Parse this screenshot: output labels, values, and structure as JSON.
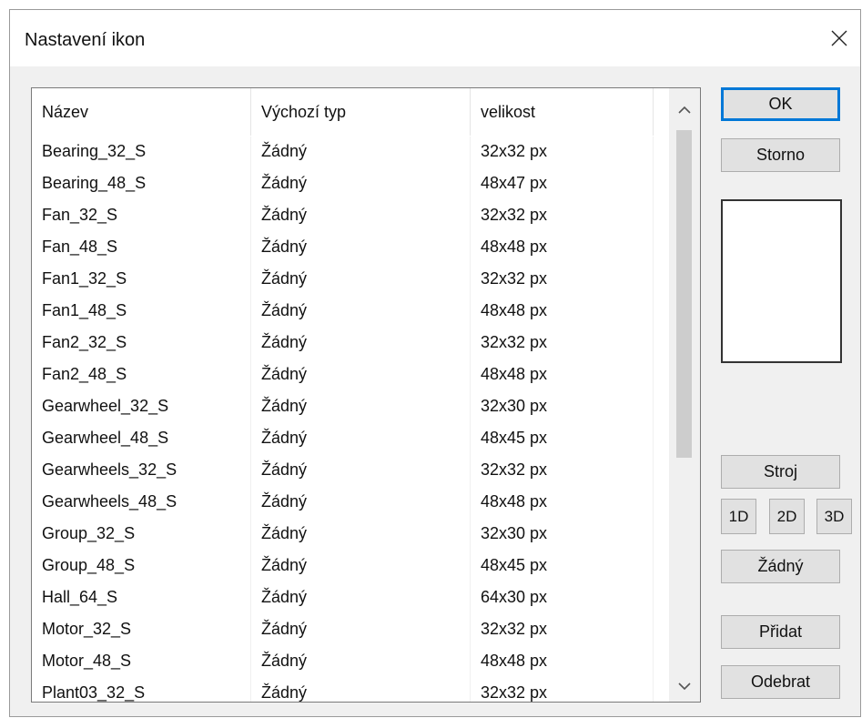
{
  "window": {
    "title": "Nastavení ikon"
  },
  "list": {
    "columns": [
      "Název",
      "Výchozí typ",
      "velikost"
    ],
    "rows": [
      {
        "name": "Bearing_32_S",
        "type": "Žádný",
        "size": "32x32 px"
      },
      {
        "name": "Bearing_48_S",
        "type": "Žádný",
        "size": "48x47 px"
      },
      {
        "name": "Fan_32_S",
        "type": "Žádný",
        "size": "32x32 px"
      },
      {
        "name": "Fan_48_S",
        "type": "Žádný",
        "size": "48x48 px"
      },
      {
        "name": "Fan1_32_S",
        "type": "Žádný",
        "size": "32x32 px"
      },
      {
        "name": "Fan1_48_S",
        "type": "Žádný",
        "size": "48x48 px"
      },
      {
        "name": "Fan2_32_S",
        "type": "Žádný",
        "size": "32x32 px"
      },
      {
        "name": "Fan2_48_S",
        "type": "Žádný",
        "size": "48x48 px"
      },
      {
        "name": "Gearwheel_32_S",
        "type": "Žádný",
        "size": "32x30 px"
      },
      {
        "name": "Gearwheel_48_S",
        "type": "Žádný",
        "size": "48x45 px"
      },
      {
        "name": "Gearwheels_32_S",
        "type": "Žádný",
        "size": "32x32 px"
      },
      {
        "name": "Gearwheels_48_S",
        "type": "Žádný",
        "size": "48x48 px"
      },
      {
        "name": "Group_32_S",
        "type": "Žádný",
        "size": "32x30 px"
      },
      {
        "name": "Group_48_S",
        "type": "Žádný",
        "size": "48x45 px"
      },
      {
        "name": "Hall_64_S",
        "type": "Žádný",
        "size": "64x30 px"
      },
      {
        "name": "Motor_32_S",
        "type": "Žádný",
        "size": "32x32 px"
      },
      {
        "name": "Motor_48_S",
        "type": "Žádný",
        "size": "48x48 px"
      },
      {
        "name": "Plant03_32_S",
        "type": "Žádný",
        "size": "32x32 px"
      }
    ]
  },
  "buttons": {
    "ok": "OK",
    "cancel": "Storno",
    "machine": "Stroj",
    "d1": "1D",
    "d2": "2D",
    "d3": "3D",
    "none": "Žádný",
    "add": "Přidat",
    "remove": "Odebrat"
  },
  "icons": {
    "close": "close-icon",
    "scroll_up": "chevron-up-icon",
    "scroll_down": "chevron-down-icon"
  },
  "colors": {
    "accent": "#0078d7",
    "dialog_bg": "#f0f0f0",
    "button_bg": "#e1e1e1"
  }
}
